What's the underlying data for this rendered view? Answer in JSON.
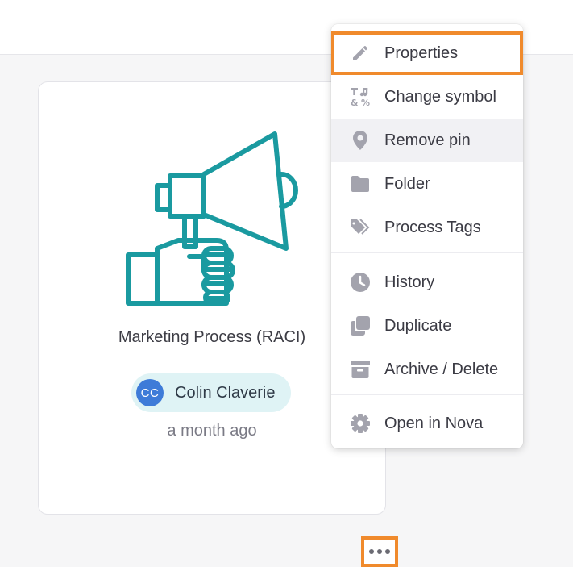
{
  "card": {
    "title": "Marketing Process (RACI)",
    "icon": "megaphone-hand-icon",
    "icon_color": "#1a9aa0",
    "owner": {
      "initials": "CC",
      "name": "Colin Claverie",
      "avatar_color": "#3e7bd8"
    },
    "updated": "a month ago",
    "more_icon": "ellipsis-icon"
  },
  "menu": {
    "items": [
      {
        "label": "Properties",
        "icon": "pencil-icon"
      },
      {
        "label": "Change symbol",
        "icon": "symbols-icon"
      },
      {
        "label": "Remove pin",
        "icon": "pin-icon"
      },
      {
        "label": "Folder",
        "icon": "folder-icon"
      },
      {
        "label": "Process Tags",
        "icon": "tags-icon"
      },
      {
        "label": "History",
        "icon": "clock-icon"
      },
      {
        "label": "Duplicate",
        "icon": "duplicate-icon"
      },
      {
        "label": "Archive / Delete",
        "icon": "archive-icon"
      },
      {
        "label": "Open in Nova",
        "icon": "gear-icon"
      }
    ],
    "icon_color": "#a3a3ad",
    "highlight_color": "#f08a2c"
  }
}
